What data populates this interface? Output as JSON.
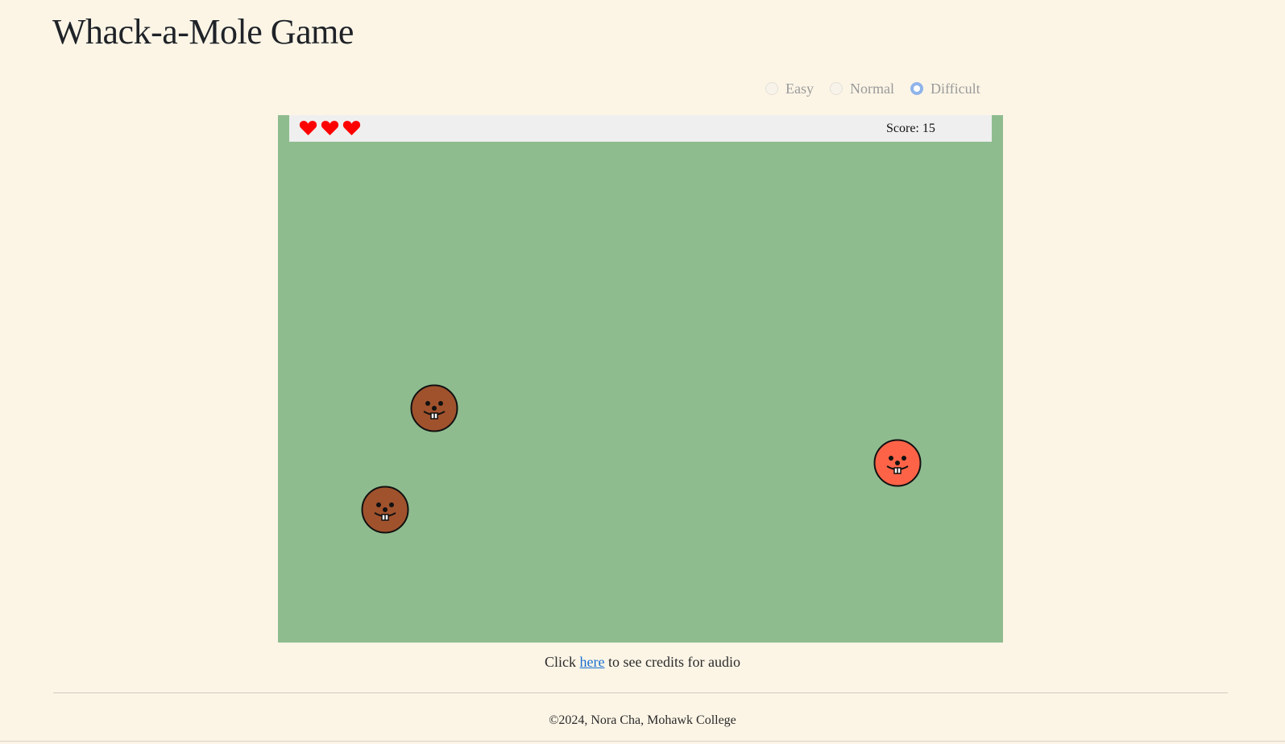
{
  "page": {
    "title": "Whack-a-Mole Game"
  },
  "difficulty": {
    "options": [
      "Easy",
      "Normal",
      "Difficult"
    ],
    "selected": "Difficult"
  },
  "game": {
    "lives": 3,
    "score_label": "Score: 15",
    "score": 15,
    "moles": [
      {
        "type": "normal",
        "color": "#a0522d"
      },
      {
        "type": "normal",
        "color": "#a0522d"
      },
      {
        "type": "special",
        "color": "#ff6347"
      }
    ]
  },
  "credits": {
    "prefix": "Click",
    "link_text": "here",
    "suffix": "to see credits for audio"
  },
  "footer": {
    "text": "©2024, Nora Cha, Mohawk College"
  },
  "colors": {
    "background": "#fcf5e6",
    "board": "#8fbc8f",
    "hud": "#efefef",
    "heart": "#ff0000",
    "link": "#1a6fd1"
  }
}
